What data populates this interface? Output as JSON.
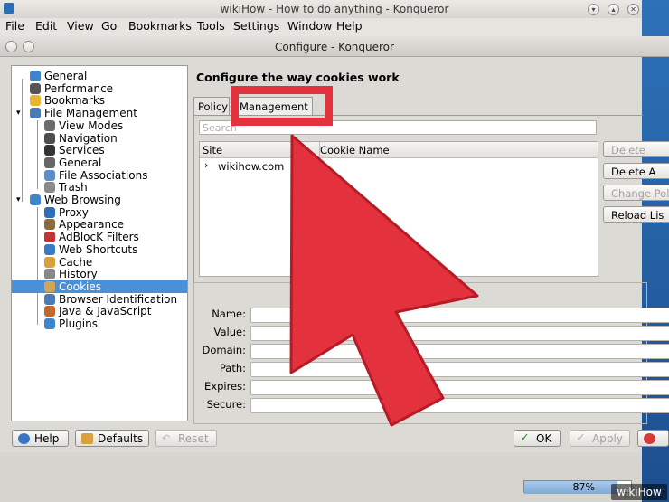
{
  "main_window": {
    "title": "wikiHow - How to do anything - Konqueror",
    "menu": [
      "File",
      "Edit",
      "View",
      "Go",
      "Bookmarks",
      "Tools",
      "Settings",
      "Window",
      "Help"
    ]
  },
  "dialog": {
    "title": "Configure - Konqueror",
    "heading": "Configure the way cookies work",
    "tree": [
      {
        "label": "General",
        "icon": "globe-icon",
        "level": 0
      },
      {
        "label": "Performance",
        "icon": "rocket-icon",
        "level": 0
      },
      {
        "label": "Bookmarks",
        "icon": "star-icon",
        "level": 0
      },
      {
        "label": "File Management",
        "icon": "folder-icon",
        "level": 0,
        "expanded": true
      },
      {
        "label": "View Modes",
        "icon": "view-icon",
        "level": 1
      },
      {
        "label": "Navigation",
        "icon": "nav-icon",
        "level": 1
      },
      {
        "label": "Services",
        "icon": "flag-icon",
        "level": 1
      },
      {
        "label": "General",
        "icon": "gear-icon",
        "level": 1
      },
      {
        "label": "File Associations",
        "icon": "file-assoc-icon",
        "level": 1
      },
      {
        "label": "Trash",
        "icon": "trash-icon",
        "level": 1
      },
      {
        "label": "Web Browsing",
        "icon": "globe-icon",
        "level": 0,
        "expanded": true
      },
      {
        "label": "Proxy",
        "icon": "proxy-icon",
        "level": 1
      },
      {
        "label": "Appearance",
        "icon": "brush-icon",
        "level": 1
      },
      {
        "label": "AdBlocK Filters",
        "icon": "block-icon",
        "level": 1
      },
      {
        "label": "Web Shortcuts",
        "icon": "shortcut-icon",
        "level": 1
      },
      {
        "label": "Cache",
        "icon": "cache-icon",
        "level": 1
      },
      {
        "label": "History",
        "icon": "history-icon",
        "level": 1
      },
      {
        "label": "Cookies",
        "icon": "cookie-icon",
        "level": 1,
        "selected": true
      },
      {
        "label": "Browser Identification",
        "icon": "id-icon",
        "level": 1
      },
      {
        "label": "Java & JavaScript",
        "icon": "java-icon",
        "level": 1
      },
      {
        "label": "Plugins",
        "icon": "plugin-icon",
        "level": 1
      }
    ],
    "tabs": [
      "Policy",
      "Management"
    ],
    "search_placeholder": "Search",
    "list": {
      "columns": [
        "Site",
        "Cookie Name"
      ],
      "rows": [
        "wikihow.com"
      ]
    },
    "side_buttons": [
      {
        "label": "Delete",
        "enabled": false
      },
      {
        "label": "Delete A",
        "enabled": true
      },
      {
        "label": "Change Pol",
        "enabled": false
      },
      {
        "label": "Reload Lis",
        "enabled": true
      }
    ],
    "details": [
      "Name:",
      "Value:",
      "Domain:",
      "Path:",
      "Expires:",
      "Secure:"
    ],
    "bottom_buttons": {
      "help": "Help",
      "defaults": "Defaults",
      "reset": "Reset",
      "ok": "OK",
      "apply": "Apply"
    }
  },
  "status": {
    "progress_text": "87%",
    "progress_value": 0.87
  },
  "watermark": "wikiHow",
  "colors": {
    "selection": "#4a90d9",
    "highlight": "#e3323d"
  }
}
